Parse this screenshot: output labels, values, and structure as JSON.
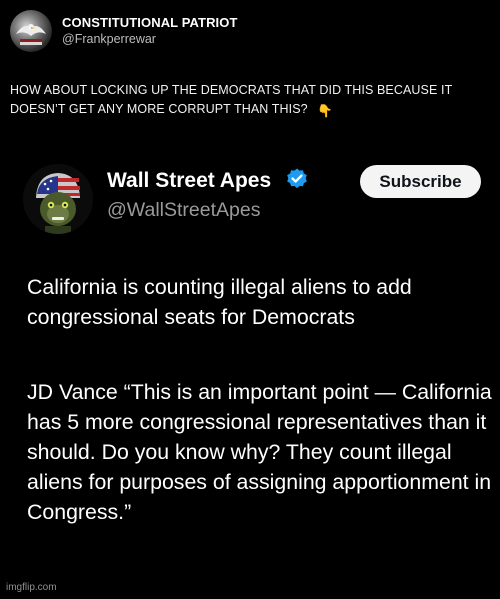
{
  "outer_post": {
    "author_name": "CONSTITUTIONAL PATRIOT",
    "author_handle": "@Frankperrewar",
    "text": "HOW ABOUT LOCKING UP THE DEMOCRATS THAT DID THIS BECAUSE  IT DOESN’T GET ANY MORE CORRUPT THAN THIS?",
    "emoji": "👇"
  },
  "embedded_post": {
    "author_name": "Wall Street Apes",
    "author_handle": "@WallStreetApes",
    "subscribe_label": "Subscribe",
    "paragraph_1": "California is counting illegal aliens to add congressional seats for Democrats",
    "paragraph_2": "JD Vance “This is an important point — California has 5 more congressional representatives than it should. Do you know why? They count illegal aliens for purposes of assigning apportionment in Congress.”"
  },
  "watermark": "imgflip.com",
  "colors": {
    "background": "#000000",
    "text": "#ffffff",
    "handle": "#9a9a9a",
    "verified": "#1d9bf0",
    "subscribe_bg": "#f4f4f4"
  },
  "icons": [
    "eagle-avatar-icon",
    "ape-avatar-icon",
    "verified-badge-icon"
  ]
}
